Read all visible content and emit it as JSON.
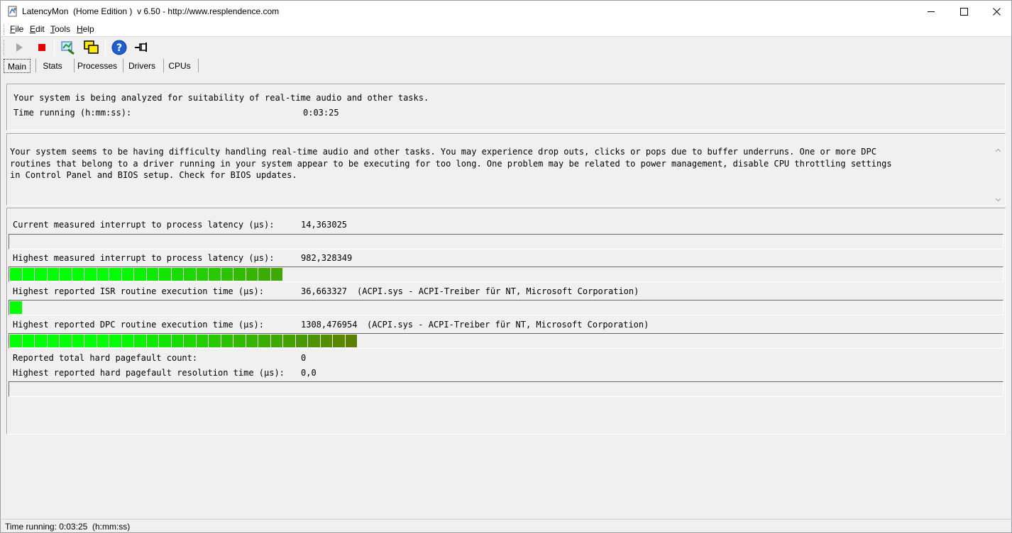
{
  "window": {
    "title": "LatencyMon  (Home Edition )  v 6.50 - http://www.resplendence.com",
    "minimize_icon": "minimize-icon",
    "maximize_icon": "maximize-icon",
    "close_icon": "close-icon"
  },
  "menu": [
    {
      "label": "File",
      "accel": "F",
      "rest": "ile"
    },
    {
      "label": "Edit",
      "accel": "E",
      "rest": "dit"
    },
    {
      "label": "Tools",
      "accel": "T",
      "rest": "ools"
    },
    {
      "label": "Help",
      "accel": "H",
      "rest": "elp"
    }
  ],
  "toolbar": {
    "icons": [
      "play-icon",
      "stop-icon",
      "analyze-icon",
      "windows-icon",
      "help-icon",
      "pin-icon"
    ]
  },
  "tabs": [
    {
      "label": "Main",
      "active": true
    },
    {
      "label": "Stats",
      "active": false
    },
    {
      "label": "Processes",
      "active": false
    },
    {
      "label": "Drivers",
      "active": false
    },
    {
      "label": "CPUs",
      "active": false
    }
  ],
  "status_panel": {
    "line1": "Your system is being analyzed for suitability of real-time audio and other tasks.",
    "time_label": "Time running (h:mm:ss):",
    "time_value": "0:03:25"
  },
  "verdict": {
    "text": "Your system seems to be having difficulty handling real-time audio and other tasks. You may experience drop outs, clicks or pops due to buffer underruns. One or more DPC\nroutines that belong to a driver running in your system appear to be executing for too long. One problem may be related to power management, disable CPU throttling settings\nin Control Panel and BIOS setup. Check for BIOS updates."
  },
  "metrics": {
    "current_latency": {
      "label": "Current measured interrupt to process latency (µs):",
      "value": "14,363025",
      "fill_segments": 0
    },
    "highest_latency": {
      "label": "Highest measured interrupt to process latency (µs):",
      "value": "982,328349",
      "fill_segments": 22
    },
    "isr": {
      "label": "Highest reported ISR routine execution time (µs):",
      "value": "36,663327",
      "detail": "(ACPI.sys - ACPI-Treiber für NT, Microsoft Corporation)",
      "fill_segments": 1
    },
    "dpc": {
      "label": "Highest reported DPC routine execution time (µs):",
      "value": "1308,476954",
      "detail": "(ACPI.sys - ACPI-Treiber für NT, Microsoft Corporation)",
      "fill_segments": 28
    },
    "pagefault_count": {
      "label": "Reported total hard pagefault count:",
      "value": "0"
    },
    "pagefault_time": {
      "label": "Highest reported hard pagefault resolution time (µs):",
      "value": "0,0",
      "fill_segments": 0
    }
  },
  "colors": {
    "bar_green": "#00ff00",
    "bar_olive": "#6b6b00"
  },
  "statusbar": {
    "text": "Time running: 0:03:25  (h:mm:ss)"
  }
}
